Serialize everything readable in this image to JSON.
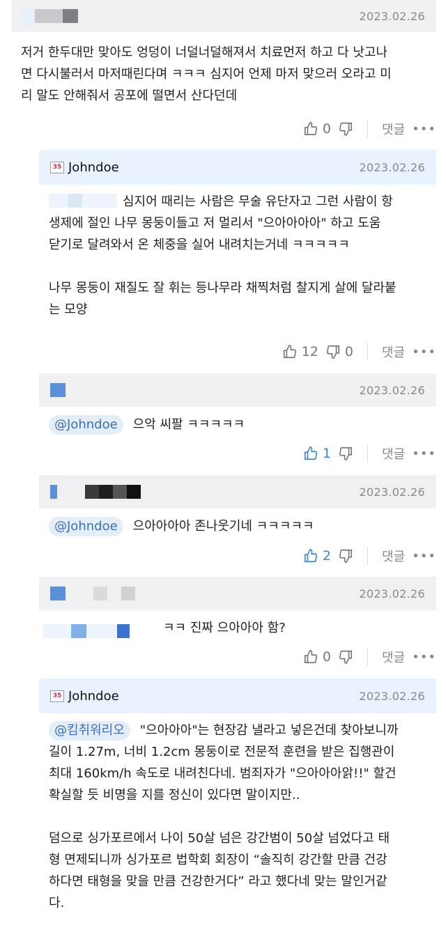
{
  "comments": [
    {
      "date": "2023.02.26",
      "body": [
        "저거 한두대만 맞아도 엉덩이 너덜너덜해져서 치료먼저 하고 다 낫고나",
        "면 다시불러서 마저때린다며 ㅋㅋㅋ 심지어 언제 마저 맞으러 오라고 미",
        "리 말도 안해줘서 공포에 떨면서 산다던데"
      ],
      "likes": "0",
      "reply_label": "댓글",
      "more": "•••"
    },
    {
      "author": "Johndoe",
      "date": "2023.02.26",
      "body": [
        "심지어 때리는 사람은 무술 유단자고 그런 사람이 항",
        "생제에 절인 나무 몽둥이들고 저 멀리서 \"으아아아아\" 하고 도움",
        "닫기로 달려와서 온 체중을 실어 내려치는거네 ㅋㅋㅋㅋㅋ",
        "",
        "나무 몽둥이 재질도 잘 휘는 등나무라 채찍처럼 찰지게 살에 달라붙",
        "는 모양"
      ],
      "likes": "12",
      "dislikes": "0",
      "reply_label": "댓글",
      "more": "•••"
    },
    {
      "date": "2023.02.26",
      "mention": "@Johndoe",
      "body": [
        "으악 씨팔 ㅋㅋㅋㅋㅋ"
      ],
      "likes": "1",
      "reply_label": "댓글",
      "more": "•••"
    },
    {
      "date": "2023.02.26",
      "mention": "@Johndoe",
      "body": [
        "으아아아아 존나웃기네 ㅋㅋㅋㅋㅋ"
      ],
      "likes": "2",
      "reply_label": "댓글",
      "more": "•••"
    },
    {
      "date": "2023.02.26",
      "body": [
        "ㅋㅋ 진짜 으아아아 함?"
      ],
      "likes": "0",
      "reply_label": "댓글",
      "more": "•••"
    },
    {
      "author": "Johndoe",
      "date": "2023.02.26",
      "mention": "@킴취워리오",
      "body": [
        "\"으아아아\"는 현장감 낼라고 넣은건데 찾아보니까",
        "길이 1.27m, 너비 1.2cm 몽둥이로 전문적 훈련을 받은 집행관이",
        "최대 160km/h 속도로 내려친다네. 범죄자가 \"으아아아앍!!\" 할건",
        "확실할 듯 비명을 지를 정신이 있다면 말이지만..",
        "",
        "덤으로 싱가포르에서 나이 50살 넘은 강간범이 50살 넘었다고 태",
        "형 면제되니까 싱가포르 법학회 회장이 “솔직히 강간할 만큼 건강",
        "하다면 태형을 맞을 만큼 건강한거다” 라고 했다네 맞는 말인거같",
        "다."
      ]
    }
  ],
  "colors": {
    "accent": "#3a84d8",
    "header_gray": "#eef0f2",
    "header_blue": "#e8f1fc"
  },
  "icons": [
    "thumbs-up-icon",
    "thumbs-down-icon",
    "more-dots-icon",
    "author-badge-icon"
  ]
}
